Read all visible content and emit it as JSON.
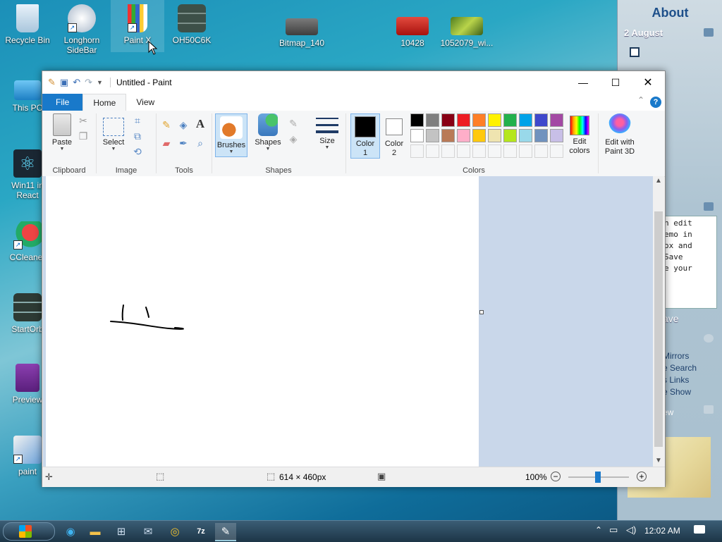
{
  "desktop": {
    "icons": [
      {
        "label": "Recycle Bin"
      },
      {
        "label": "Longhorn SideBar"
      },
      {
        "label": "Paint X"
      },
      {
        "label": "OH50C6K"
      },
      {
        "label": "Bitmap_140"
      },
      {
        "label": "10428"
      },
      {
        "label": "1052079_wi..."
      },
      {
        "label": "This PC"
      },
      {
        "label": "Win11 in React"
      },
      {
        "label": "CCleaner"
      },
      {
        "label": "StartOrb"
      },
      {
        "label": "Preview"
      },
      {
        "label": "paint"
      }
    ]
  },
  "sidebar": {
    "title": "About",
    "date": "2 August",
    "memo_text": "n edit\nemo in\nox and\nSave\ne your",
    "save_label": "ave",
    "links": [
      "Mirrors",
      "e Search",
      "s Links",
      "e Show"
    ],
    "gadget_label": "ew"
  },
  "paint": {
    "title": "Untitled - Paint",
    "tabs": [
      "File",
      "Home",
      "View"
    ],
    "groups": {
      "clipboard": "Clipboard",
      "image": "Image",
      "tools": "Tools",
      "shapes": "Shapes",
      "colors": "Colors"
    },
    "buttons": {
      "paste": "Paste",
      "select": "Select",
      "brushes": "Brushes",
      "shapes": "Shapes",
      "size": "Size",
      "color1": "Color 1",
      "color2": "Color 2",
      "edit_colors": "Edit colors",
      "edit_paint3d": "Edit with Paint 3D"
    },
    "palette_row1": [
      "#000000",
      "#7f7f7f",
      "#880015",
      "#ed1c24",
      "#ff7f27",
      "#fff200",
      "#22b14c",
      "#00a2e8",
      "#3f48cc",
      "#a349a4"
    ],
    "palette_row2": [
      "#ffffff",
      "#c3c3c3",
      "#b97a57",
      "#ffaec9",
      "#ffc90e",
      "#efe4b0",
      "#b5e61d",
      "#99d9ea",
      "#7092be",
      "#c8bfe7"
    ],
    "status": {
      "dimensions": "614 × 460px",
      "zoom": "100%"
    }
  },
  "taskbar": {
    "clock": "12:02 AM"
  }
}
